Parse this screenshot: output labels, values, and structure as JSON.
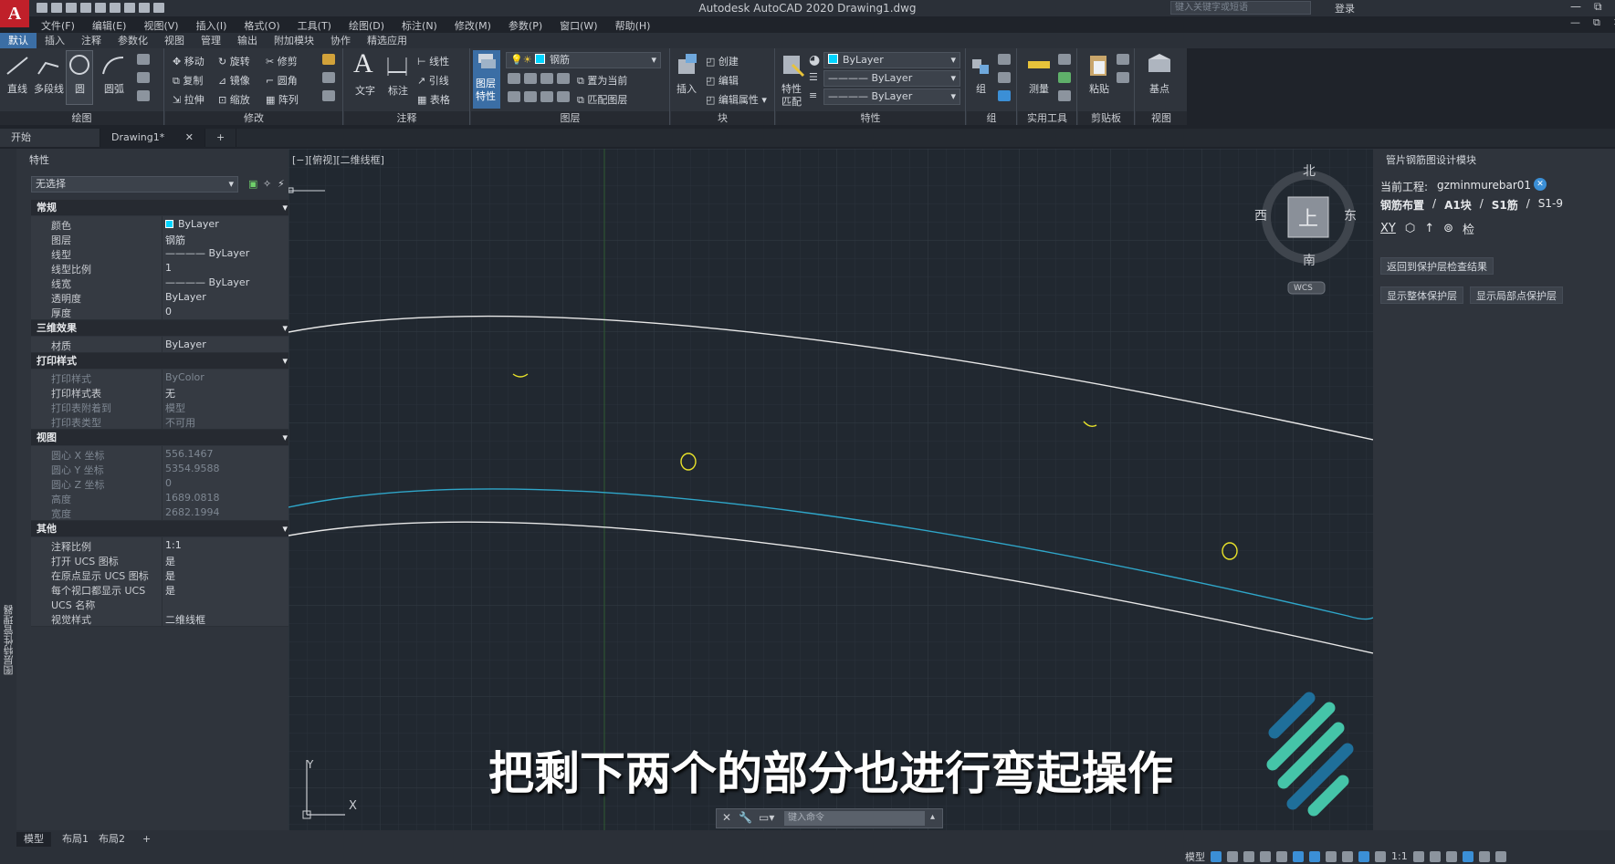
{
  "app": {
    "title": "Autodesk AutoCAD 2020    Drawing1.dwg",
    "logo": "A",
    "search_placeholder": "键入关键字或短语",
    "login": "登录",
    "window_controls": [
      "—",
      "⧉",
      "✕"
    ]
  },
  "menu": [
    "文件(F)",
    "编辑(E)",
    "视图(V)",
    "插入(I)",
    "格式(O)",
    "工具(T)",
    "绘图(D)",
    "标注(N)",
    "修改(M)",
    "参数(P)",
    "窗口(W)",
    "帮助(H)"
  ],
  "ribbon_tabs": [
    "默认",
    "插入",
    "注释",
    "参数化",
    "视图",
    "管理",
    "输出",
    "附加模块",
    "协作",
    "精选应用"
  ],
  "ribbon": {
    "draw": {
      "title": "绘图",
      "tools": [
        "直线",
        "多段线",
        "圆",
        "圆弧"
      ]
    },
    "modify": {
      "title": "修改",
      "tools": [
        "移动",
        "旋转",
        "修剪",
        "复制",
        "镜像",
        "圆角",
        "拉伸",
        "缩放",
        "阵列"
      ]
    },
    "annotation": {
      "title": "注释",
      "tools": [
        "文字",
        "标注",
        "线性",
        "引线",
        "表格"
      ]
    },
    "layers": {
      "title": "图层",
      "big": "图层\n特性",
      "current_layer": "钢筋",
      "tools": [
        "置为当前",
        "匹配图层"
      ]
    },
    "block": {
      "title": "块",
      "tools": [
        "插入",
        "创建",
        "编辑",
        "编辑属性"
      ]
    },
    "properties": {
      "title": "特性",
      "big": "特性\n匹配",
      "color": "ByLayer",
      "linetype": "ByLayer",
      "lineweight": "ByLayer"
    },
    "groups": {
      "title": "组",
      "tools": [
        "组"
      ]
    },
    "utilities": {
      "title": "实用工具",
      "tools": [
        "测量"
      ]
    },
    "clipboard": {
      "title": "剪贴板",
      "tools": [
        "粘贴"
      ]
    },
    "view": {
      "title": "视图",
      "tools": [
        "基点"
      ]
    }
  },
  "doc_tabs": [
    "开始",
    "Drawing1*"
  ],
  "properties_panel": {
    "title": "特性",
    "selection": "无选择",
    "sections": [
      {
        "name": "常规",
        "rows": [
          {
            "k": "颜色",
            "v": "ByLayer",
            "swatch": true
          },
          {
            "k": "图层",
            "v": "钢筋"
          },
          {
            "k": "线型",
            "v": "———— ByLayer"
          },
          {
            "k": "线型比例",
            "v": "1"
          },
          {
            "k": "线宽",
            "v": "———— ByLayer"
          },
          {
            "k": "透明度",
            "v": "ByLayer"
          },
          {
            "k": "厚度",
            "v": "0"
          }
        ]
      },
      {
        "name": "三维效果",
        "rows": [
          {
            "k": "材质",
            "v": "ByLayer"
          }
        ]
      },
      {
        "name": "打印样式",
        "rows": [
          {
            "k": "打印样式",
            "v": "ByColor",
            "dim": true
          },
          {
            "k": "打印样式表",
            "v": "无"
          },
          {
            "k": "打印表附着到",
            "v": "模型",
            "dim": true
          },
          {
            "k": "打印表类型",
            "v": "不可用",
            "dim": true
          }
        ]
      },
      {
        "name": "视图",
        "rows": [
          {
            "k": "圆心 X 坐标",
            "v": "556.1467",
            "dim": true
          },
          {
            "k": "圆心 Y 坐标",
            "v": "5354.9588",
            "dim": true
          },
          {
            "k": "圆心 Z 坐标",
            "v": "0",
            "dim": true
          },
          {
            "k": "高度",
            "v": "1689.0818",
            "dim": true
          },
          {
            "k": "宽度",
            "v": "2682.1994",
            "dim": true
          }
        ]
      },
      {
        "name": "其他",
        "rows": [
          {
            "k": "注释比例",
            "v": "1:1"
          },
          {
            "k": "打开 UCS 图标",
            "v": "是"
          },
          {
            "k": "在原点显示 UCS 图标",
            "v": "是"
          },
          {
            "k": "每个视口都显示 UCS",
            "v": "是"
          },
          {
            "k": "UCS 名称",
            "v": ""
          },
          {
            "k": "视觉样式",
            "v": "二维线框"
          }
        ]
      }
    ]
  },
  "left_strip_text": "图层特性管理器",
  "viewport": {
    "label": "[−][俯视][二维线框]",
    "compass": {
      "n": "北",
      "s": "南",
      "e": "东",
      "w": "西",
      "top": "上",
      "wcs": "WCS"
    },
    "ucs": {
      "x": "X",
      "y": "Y"
    }
  },
  "right_panel": {
    "title": "管片钢筋图设计模块",
    "project_label": "当前工程:",
    "project_name": "gzminmurebar01",
    "breadcrumb": [
      "钢筋布置",
      "A1块",
      "S1筋",
      "S1-9"
    ],
    "breadcrumb_sep": "/",
    "tools": [
      "XY",
      "检"
    ],
    "buttons": [
      "返回到保护层检查结果",
      "显示整体保护层",
      "显示局部点保护层"
    ]
  },
  "caption": "把剩下两个的部分也进行弯起操作",
  "command": {
    "placeholder": "键入命令"
  },
  "status": {
    "tabs": [
      "模型",
      "布局1",
      "布局2"
    ],
    "model": "模型",
    "scale": "1:1"
  },
  "colors": {
    "accent": "#3b6ea5",
    "cyan_curve": "#2fa6c9",
    "white_curve": "#e8e8e8",
    "yellow": "#e8e22a",
    "logo_red": "#c0202a"
  }
}
